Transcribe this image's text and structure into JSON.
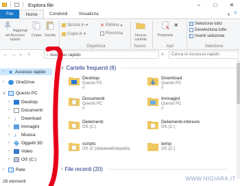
{
  "window": {
    "title": "Esplora file",
    "min": "–",
    "max": "□",
    "close": "✕"
  },
  "tabs": {
    "file": "File",
    "home": "Home",
    "share": "Condividi",
    "view": "Visualizza",
    "expand": "∨",
    "help": "?"
  },
  "ribbon": {
    "pin_label": "Aggiungi ad Accesso rapido",
    "copy_label": "Copia",
    "paste_label": "Incolla",
    "move_to": "Sposta in",
    "copy_to": "Copia in",
    "delete": "Elimina",
    "rename": "Rinomina",
    "new_folder": "Nuova cartella",
    "properties": "Proprietà",
    "select_all": "Seleziona tutto",
    "select_none": "Deseleziona tutto",
    "invert_selection": "Inverti selezione",
    "group_organize": "Organizza",
    "group_new": "Nuovo",
    "group_open": "Apri",
    "group_select": "Seleziona"
  },
  "address": {
    "back": "←",
    "forward": "→",
    "recent": "∨",
    "up": "↑",
    "breadcrumb": "Accesso rapido",
    "search_placeholder": "Cerca in Accesso rapido"
  },
  "nav": {
    "quick_access": "Accesso rapido",
    "onedrive": "OneDrive",
    "this_pc": "Questo PC",
    "desktop": "Desktop",
    "documents": "Documenti",
    "downloads": "Download",
    "images": "Immagini",
    "music": "Musica",
    "objects3d": "Oggetti 3D",
    "video": "Video",
    "os_c": "OS (C:)",
    "network": "Rete"
  },
  "status": {
    "count": "28 elementi"
  },
  "content": {
    "frequent_header": "Cartelle frequenti (8)",
    "recent_header": "File recenti (20)",
    "folders": [
      {
        "name": "Desktop",
        "location": "Questo PC"
      },
      {
        "name": "Download",
        "location": "Questo PC"
      },
      {
        "name": "Documenti",
        "location": "Questo PC"
      },
      {
        "name": "Immagini",
        "location": "Questo PC"
      },
      {
        "name": "Delementi",
        "location": "OS (C:)"
      },
      {
        "name": "Delementi-inbrevis",
        "location": "OS (C:)"
      },
      {
        "name": "scripts",
        "location": "OS (C:)\\data\\web\\okpedia"
      },
      {
        "name": "temp",
        "location": "OS (C:)"
      }
    ]
  },
  "watermark": "WWW.NIGIARA.IT",
  "colors": {
    "accent": "#1979ca",
    "annotation": "#e8001a",
    "selected": "#cce8ff",
    "header": "#1e3287"
  }
}
